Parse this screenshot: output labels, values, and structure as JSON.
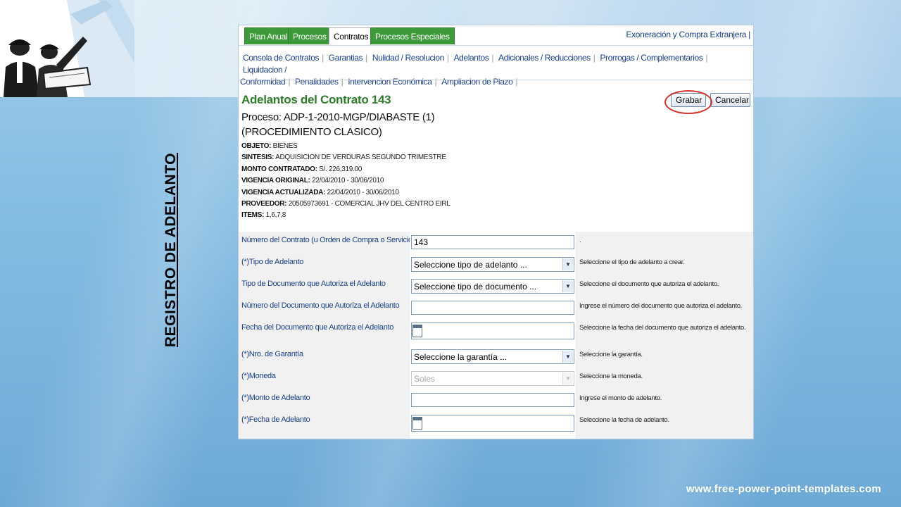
{
  "slide": {
    "side_title": "REGISTRO DE ADELANTO",
    "footer_url": "www.free-power-point-templates.com"
  },
  "tabs": [
    {
      "label": "Plan Anual",
      "active": false
    },
    {
      "label": "Procesos",
      "active": false
    },
    {
      "label": "Contratos",
      "active": true
    },
    {
      "label": "Procesos Especiales",
      "active": false
    }
  ],
  "top_right_link": "Exoneración y Compra Extranjera |",
  "subnav": [
    "Consola de Contratos",
    "Garantias",
    "Nulidad / Resolucion",
    "Adelantos",
    "Adicionales / Reducciones",
    "Prorrogas / Complementarios",
    "Liquidacion /",
    "Conformidad",
    "Penalidades",
    "Intervencion Económica",
    "Ampliacion de Plazo"
  ],
  "header": {
    "title": "Adelantos del Contrato 143",
    "proceso_line1": "Proceso: ADP-1-2010-MGP/DIABASTE (1)",
    "proceso_line2": "(PROCEDIMIENTO CLASICO)"
  },
  "meta": [
    {
      "key": "OBJETO:",
      "value": "BIENES"
    },
    {
      "key": "SINTESIS:",
      "value": "ADQUISICION DE VERDURAS SEGUNDO TRIMESTRE"
    },
    {
      "key": "MONTO CONTRATADO:",
      "value": "S/.  226,319.00"
    },
    {
      "key": "VIGENCIA ORIGINAL:",
      "value": "22/04/2010 - 30/06/2010"
    },
    {
      "key": "VIGENCIA ACTUALIZADA:",
      "value": "22/04/2010 - 30/06/2010"
    },
    {
      "key": "PROVEEDOR:",
      "value": "20505973691 - COMERCIAL JHV DEL CENTRO EIRL"
    },
    {
      "key": "ITEMS:",
      "value": "1,6,7,8"
    }
  ],
  "buttons": {
    "grabar": "Grabar",
    "cancelar": "Cancelar"
  },
  "accent_colors": {
    "tab_green": "#3d9a3a",
    "title_green": "#2d7d2a",
    "link_blue": "#1a3f8a",
    "highlight_red": "#d4302a"
  },
  "form": [
    {
      "label": "Número del Contrato (u Orden de Compra o Servicio)",
      "type": "input",
      "value": "143",
      "hint": "."
    },
    {
      "label": "(*)Tipo de Adelanto",
      "type": "select",
      "value": "Seleccione tipo de adelanto ...",
      "hint": "Seleccione el tipo de adelanto a crear."
    },
    {
      "label": "Tipo de Documento que Autoriza el Adelanto",
      "type": "select",
      "value": "Seleccione tipo de documento ...",
      "hint": "Seleccione el documento que autoriza el adelanto."
    },
    {
      "label": "Número del Documento que Autoriza el Adelanto",
      "type": "input",
      "value": "",
      "hint": "Ingrese el número del documento que autoriza el adelanto."
    },
    {
      "label": "Fecha del Documento que Autoriza el Adelanto",
      "type": "date",
      "value": "",
      "hint": "Seleccione la fecha del documento que autoriza el adelanto."
    },
    {
      "label": "(*)Nro. de Garantía",
      "type": "select",
      "value": "Seleccione la garantía ...",
      "hint": "Seleccione la garantía."
    },
    {
      "label": "(*)Moneda",
      "type": "select-disabled",
      "value": "Soles",
      "hint": "Seleccione la moneda."
    },
    {
      "label": "(*)Monto de Adelanto",
      "type": "input",
      "value": "",
      "hint": "Ingrese el monto de adelanto."
    },
    {
      "label": "(*)Fecha de Adelanto",
      "type": "date",
      "value": "",
      "hint": "Seleccione la fecha de adelanto."
    }
  ]
}
